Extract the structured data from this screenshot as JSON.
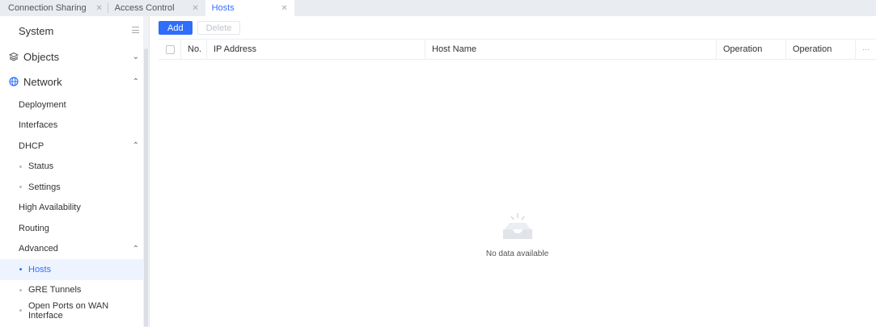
{
  "tabs": [
    {
      "label": "Connection Sharing",
      "active": false
    },
    {
      "label": "Access Control",
      "active": false
    },
    {
      "label": "Hosts",
      "active": true
    }
  ],
  "sidebar": {
    "system_label": "System",
    "objects_label": "Objects",
    "network_label": "Network",
    "items": {
      "deployment": "Deployment",
      "interfaces": "Interfaces",
      "dhcp": "DHCP",
      "status": "Status",
      "settings": "Settings",
      "high_availability": "High Availability",
      "routing": "Routing",
      "advanced": "Advanced",
      "hosts": "Hosts",
      "gre_tunnels": "GRE Tunnels",
      "open_ports": "Open Ports on WAN Interface"
    }
  },
  "toolbar": {
    "add_label": "Add",
    "delete_label": "Delete"
  },
  "table": {
    "columns": [
      "No.",
      "IP Address",
      "Host Name",
      "Operation",
      "Operation"
    ],
    "more_label": "···",
    "empty_text": "No data available"
  },
  "colors": {
    "accent": "#2f6dfb",
    "selected_bg": "#eef4ff"
  }
}
